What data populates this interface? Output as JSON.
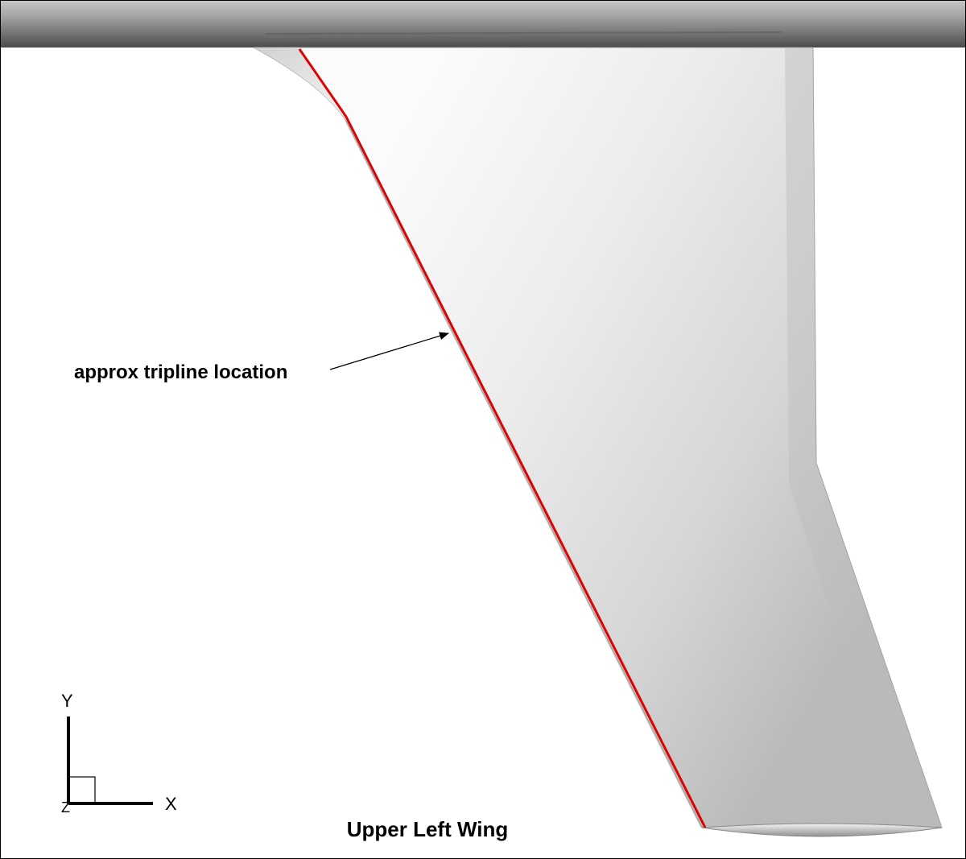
{
  "annotation": {
    "label": "approx tripline location"
  },
  "plot_title": "Upper Left Wing",
  "axes_triad": {
    "y_label": "Y",
    "x_label": "X",
    "z_label": "Z"
  },
  "colors": {
    "background": "#ffffff",
    "fuselage": "#8a8a8a",
    "wing_surface": "#d9d9d9",
    "tripline": "#e00000",
    "annotation_text": "#000000"
  }
}
